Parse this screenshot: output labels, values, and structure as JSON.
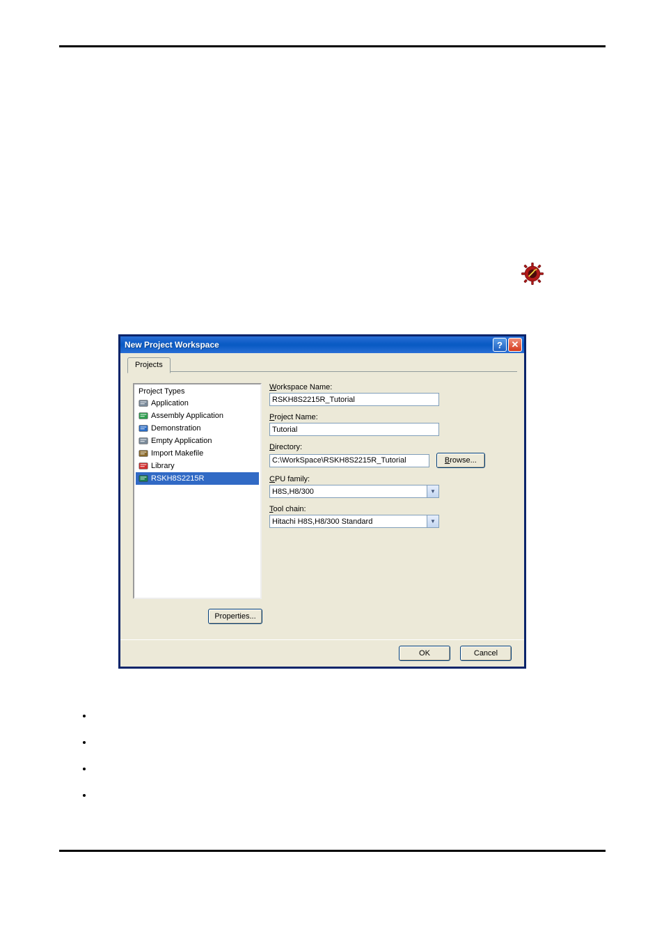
{
  "dialog": {
    "title": "New Project Workspace",
    "tab": "Projects",
    "projectTypes": {
      "header": "Project Types",
      "items": [
        {
          "label": "Application",
          "iconColor": "#7a8a9a"
        },
        {
          "label": "Assembly Application",
          "iconColor": "#2e9e4f"
        },
        {
          "label": "Demonstration",
          "iconColor": "#2b6cc4"
        },
        {
          "label": "Empty Application",
          "iconColor": "#7a8a9a"
        },
        {
          "label": "Import Makefile",
          "iconColor": "#8a6a2b"
        },
        {
          "label": "Library",
          "iconColor": "#d22d2d"
        },
        {
          "label": "RSKH8S2215R",
          "iconColor": "#1f7f54"
        }
      ],
      "selectedIndex": 6
    },
    "propertiesBtn": "Properties...",
    "form": {
      "workspaceNameLabel": "Workspace Name:",
      "workspaceNameValue": "RSKH8S2215R_Tutorial",
      "projectNameLabel": "Project Name:",
      "projectNameValue": "Tutorial",
      "directoryLabel": "Directory:",
      "directoryValue": "C:\\WorkSpace\\RSKH8S2215R_Tutorial",
      "browseBtn": "Browse...",
      "cpuFamilyLabel": "CPU family:",
      "cpuFamilyValue": "H8S,H8/300",
      "toolChainLabel": "Tool chain:",
      "toolChainValue": "Hitachi H8S,H8/300 Standard"
    },
    "okBtn": "OK",
    "cancelBtn": "Cancel"
  }
}
